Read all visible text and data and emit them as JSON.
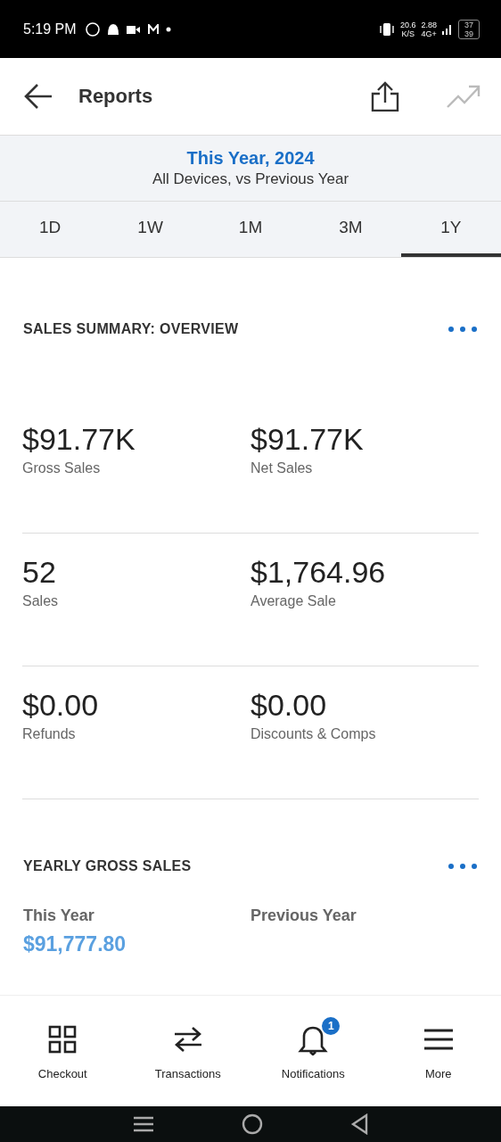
{
  "status_bar": {
    "time": "5:19 PM",
    "speed": "20.6",
    "speed_unit": "K/S",
    "data_rate": "2.88",
    "network": "4G+",
    "battery_texts": [
      "37",
      "39"
    ]
  },
  "header": {
    "title": "Reports"
  },
  "period": {
    "title": "This Year, 2024",
    "subtitle": "All Devices, vs Previous Year"
  },
  "tabs": [
    {
      "label": "1D",
      "selected": false
    },
    {
      "label": "1W",
      "selected": false
    },
    {
      "label": "1M",
      "selected": false
    },
    {
      "label": "3M",
      "selected": false
    },
    {
      "label": "1Y",
      "selected": true
    }
  ],
  "summary": {
    "title": "SALES SUMMARY: OVERVIEW",
    "metrics": [
      {
        "value": "$91.77K",
        "label": "Gross Sales"
      },
      {
        "value": "$91.77K",
        "label": "Net Sales"
      },
      {
        "value": "52",
        "label": "Sales"
      },
      {
        "value": "$1,764.96",
        "label": "Average Sale"
      },
      {
        "value": "$0.00",
        "label": "Refunds"
      },
      {
        "value": "$0.00",
        "label": "Discounts & Comps"
      }
    ]
  },
  "yearly": {
    "title": "YEARLY GROSS SALES",
    "this_year_label": "This Year",
    "this_year_value": "$91,777.80",
    "previous_year_label": "Previous Year"
  },
  "bottom_nav": [
    {
      "kind": "grid",
      "label": "Checkout"
    },
    {
      "kind": "swap",
      "label": "Transactions"
    },
    {
      "kind": "bell",
      "label": "Notifications",
      "badge": "1"
    },
    {
      "kind": "menu",
      "label": "More"
    }
  ]
}
